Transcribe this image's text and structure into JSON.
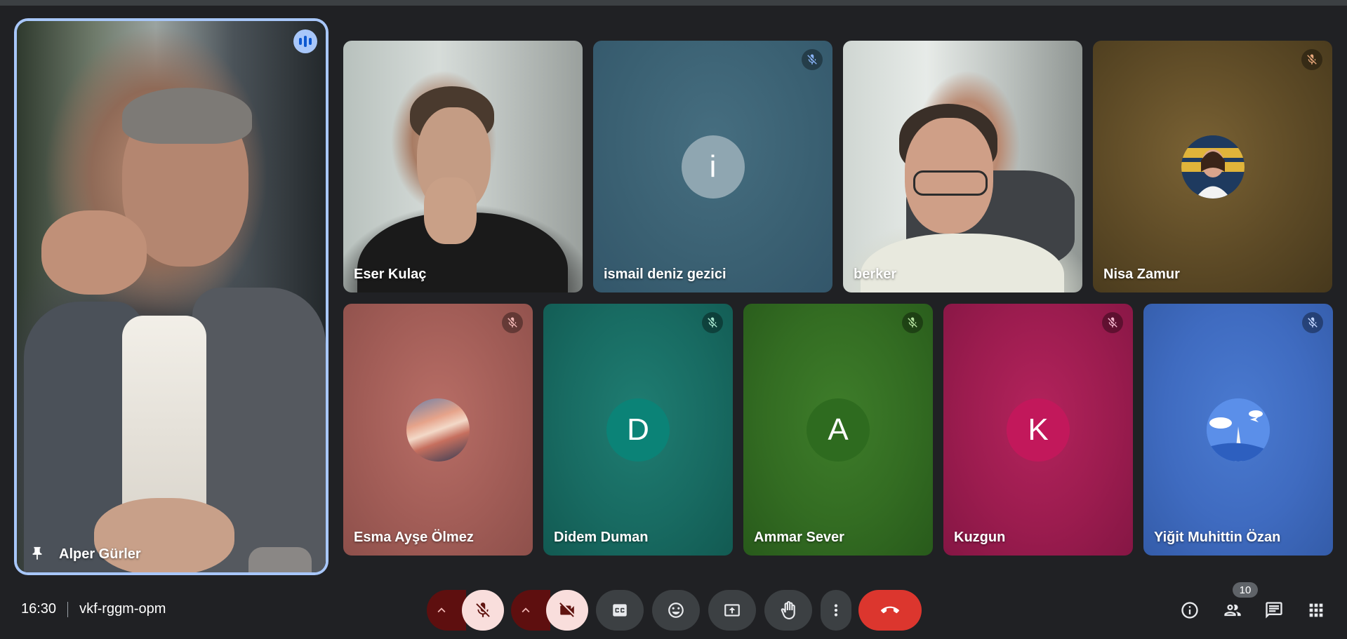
{
  "participants": {
    "pinned": {
      "name": "Alper Gürler"
    },
    "tiles": [
      {
        "name": "Eser Kulaç"
      },
      {
        "name": "ismail deniz gezici",
        "initial": "i"
      },
      {
        "name": "berker"
      },
      {
        "name": "Nisa Zamur"
      },
      {
        "name": "Esma Ayşe Ölmez"
      },
      {
        "name": "Didem Duman",
        "initial": "D"
      },
      {
        "name": "Ammar Sever",
        "initial": "A"
      },
      {
        "name": "Kuzgun",
        "initial": "K"
      },
      {
        "name": "Yiğit Muhittin Özan"
      }
    ]
  },
  "meeting": {
    "time": "16:30",
    "code": "vkf-rggm-opm"
  },
  "people_count": "10",
  "icons": {
    "speaking": "audio-level-icon",
    "pin": "pin-icon",
    "mic_muted": "mic-off-icon",
    "camera_off": "camera-off-icon",
    "captions": "closed-captions-icon",
    "reactions": "emoji-icon",
    "present": "present-screen-icon",
    "hand": "raise-hand-icon",
    "more": "more-vert-icon",
    "leave": "call-end-icon",
    "info": "info-icon",
    "people": "people-icon",
    "chat": "chat-icon",
    "activities": "apps-grid-icon"
  },
  "colors": {
    "background": "#202124",
    "speaking_outline": "#a8c7fa",
    "leave": "#dc362e",
    "muted_bg": "#f9dedc"
  }
}
